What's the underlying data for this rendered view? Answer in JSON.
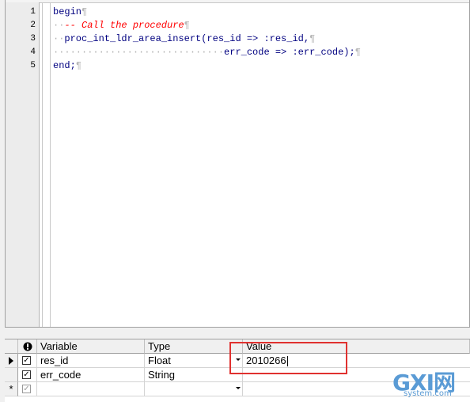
{
  "editor": {
    "line_numbers": [
      "1",
      "2",
      "3",
      "4",
      "5"
    ],
    "lines": [
      {
        "text": "begin"
      },
      {
        "lead": "··",
        "comment": "-- Call the procedure"
      },
      {
        "lead": "··",
        "text": "proc_int_ldr_area_insert(res_id => :res_id,"
      },
      {
        "lead": "······························",
        "text": "err_code => :err_code);"
      },
      {
        "text": "end;"
      }
    ],
    "pilcrow": "¶"
  },
  "grid": {
    "columns": [
      "Variable",
      "Type",
      "Value"
    ],
    "rows": [
      {
        "variable": "res_id",
        "type": "Float",
        "value": "2010266",
        "checked": "✓"
      },
      {
        "variable": "err_code",
        "type": "String",
        "value": "",
        "checked": "✓"
      },
      {
        "variable": "",
        "type": "",
        "value": "",
        "checked": "✓",
        "indicator": "*"
      }
    ],
    "header_icon": "info-icon"
  },
  "watermark": {
    "big": "GXI网",
    "small": "system.com"
  },
  "colors": {
    "highlight": "#e0312f",
    "comment": "#ff0000",
    "code": "#000080"
  }
}
